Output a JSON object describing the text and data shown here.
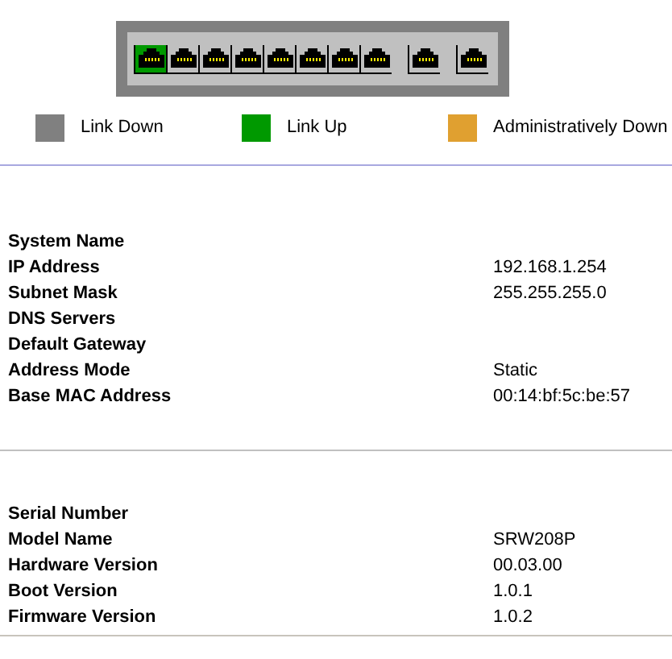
{
  "port_groups": [
    {
      "ports": [
        {
          "link_up": true
        },
        {
          "link_up": false
        },
        {
          "link_up": false
        },
        {
          "link_up": false
        },
        {
          "link_up": false
        },
        {
          "link_up": false
        },
        {
          "link_up": false
        },
        {
          "link_up": false
        }
      ]
    },
    {
      "ports": [
        {
          "link_up": false
        }
      ]
    },
    {
      "ports": [
        {
          "link_up": false
        }
      ]
    }
  ],
  "legend": [
    {
      "label": "Link Down",
      "color": "#808080"
    },
    {
      "label": "Link Up",
      "color": "#009900"
    },
    {
      "label": "Administratively Down",
      "color": "#e0a030"
    }
  ],
  "system_info": [
    {
      "label": "System Name"
    },
    {
      "label": "IP Address",
      "value": "192.168.1.254"
    },
    {
      "label": "Subnet Mask",
      "value": "255.255.255.0"
    },
    {
      "label": "DNS Servers"
    },
    {
      "label": "Default Gateway"
    },
    {
      "label": "Address Mode",
      "value": "Static"
    },
    {
      "label": "Base MAC Address",
      "value": "00:14:bf:5c:be:57"
    }
  ],
  "device_info": [
    {
      "label": "Serial Number"
    },
    {
      "label": "Model Name",
      "value": "SRW208P"
    },
    {
      "label": "Hardware Version",
      "value": "00.03.00"
    },
    {
      "label": "Boot Version",
      "value": "1.0.1"
    },
    {
      "label": "Firmware Version",
      "value": "1.0.2"
    }
  ]
}
